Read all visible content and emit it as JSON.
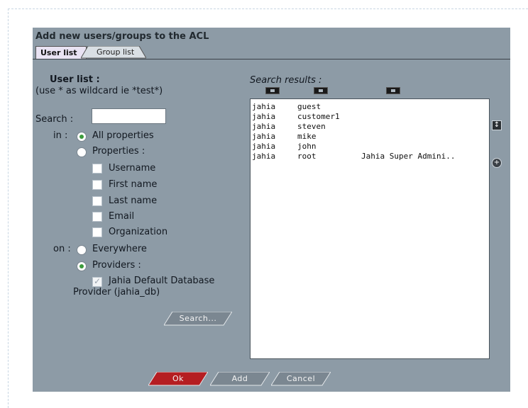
{
  "panel": {
    "title": "Add new users/groups to the ACL",
    "tabs": [
      {
        "label": "User list",
        "active": true
      },
      {
        "label": "Group list",
        "active": false
      }
    ]
  },
  "left": {
    "heading": "User list :",
    "hint": "(use * as wildcard ie *test*)",
    "search_label": "Search :",
    "search_value": "",
    "in_label": "in :",
    "in_options": [
      {
        "label": "All properties",
        "checked": true
      },
      {
        "label": "Properties :",
        "checked": false
      }
    ],
    "properties": [
      {
        "label": "Username",
        "checked": false
      },
      {
        "label": "First name",
        "checked": false
      },
      {
        "label": "Last name",
        "checked": false
      },
      {
        "label": "Email",
        "checked": false
      },
      {
        "label": "Organization",
        "checked": false
      }
    ],
    "on_label": "on :",
    "on_options": [
      {
        "label": "Everywhere",
        "checked": false
      },
      {
        "label": "Providers :",
        "checked": true
      }
    ],
    "provider_line1": "Jahia Default Database",
    "provider_line2": "Provider (jahia_db)",
    "provider_checked": true,
    "search_button": "Search..."
  },
  "results": {
    "title": "Search results :",
    "rows": [
      {
        "provider": "jahia",
        "name": "guest",
        "full": ""
      },
      {
        "provider": "jahia",
        "name": "customer1",
        "full": ""
      },
      {
        "provider": "jahia",
        "name": "steven",
        "full": ""
      },
      {
        "provider": "jahia",
        "name": "mike",
        "full": ""
      },
      {
        "provider": "jahia",
        "name": "john",
        "full": ""
      },
      {
        "provider": "jahia",
        "name": "root",
        "full": "Jahia Super Admini.."
      }
    ],
    "side_icons": [
      "sort-toggle-icon",
      "add-icon"
    ]
  },
  "footer": {
    "ok": "Ok",
    "add": "Add",
    "cancel": "Cancel"
  },
  "colors": {
    "panel_bg": "#8d9ba6",
    "ok_button": "#b51e22",
    "grey_button": "#7b8791",
    "radio_dot": "#3c9b3c"
  }
}
